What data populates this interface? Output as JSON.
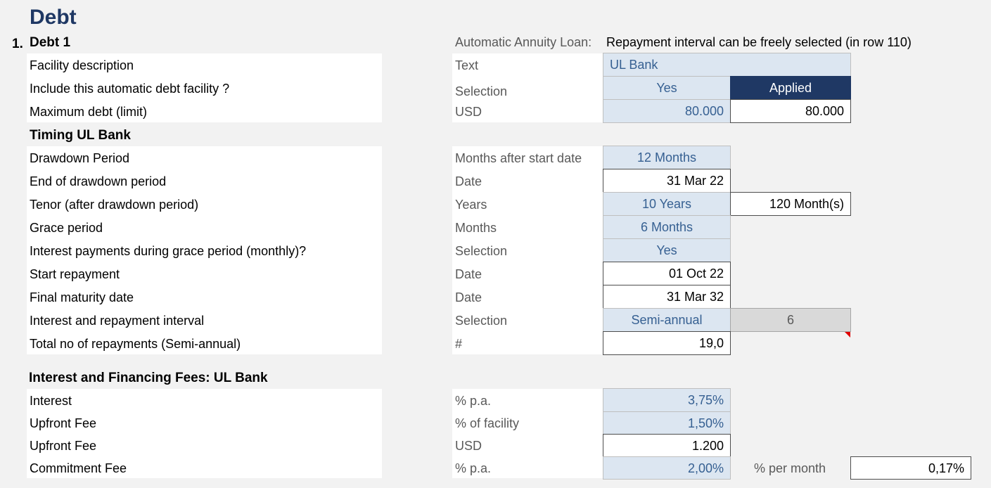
{
  "page_title": "Debt",
  "debt": {
    "number": "1.",
    "name": "Debt 1",
    "annuity_label": "Automatic Annuity Loan:",
    "annuity_note": "Repayment interval can be freely selected (in row 110)"
  },
  "rows": {
    "facility": {
      "label": "Facility description",
      "unit": "Text",
      "value": "UL Bank"
    },
    "include": {
      "label": "Include this automatic debt facility ?",
      "unit": "Selection",
      "value": "Yes",
      "status": "Applied"
    },
    "maxdebt": {
      "label": "Maximum debt (limit)",
      "unit": "USD",
      "value": "80.000",
      "calc": "80.000"
    },
    "drawdown": {
      "label": "Drawdown Period",
      "unit": "Months after start date",
      "value": "12 Months"
    },
    "enddraw": {
      "label": "End of drawdown period",
      "unit": "Date",
      "value": "31 Mar 22"
    },
    "tenor": {
      "label": "Tenor (after drawdown period)",
      "unit": "Years",
      "value": "10 Years",
      "calc": "120 Month(s)"
    },
    "grace": {
      "label": "Grace period",
      "unit": "Months",
      "value": "6 Months"
    },
    "graceint": {
      "label": "Interest payments during grace period (monthly)?",
      "unit": "Selection",
      "value": "Yes"
    },
    "startrep": {
      "label": "Start repayment",
      "unit": "Date",
      "value": "01 Oct 22"
    },
    "maturity": {
      "label": "Final maturity date",
      "unit": "Date",
      "value": "31 Mar 32"
    },
    "interval": {
      "label": "Interest and repayment interval",
      "unit": "Selection",
      "value": "Semi-annual",
      "calc": "6"
    },
    "norepay": {
      "label": "Total no of repayments (Semi-annual)",
      "unit": "#",
      "value": "19,0"
    },
    "interest": {
      "label": "Interest",
      "unit": "% p.a.",
      "value": "3,75%"
    },
    "upfrontpct": {
      "label": "Upfront Fee",
      "unit": "% of facility",
      "value": "1,50%"
    },
    "upfrontusd": {
      "label": "Upfront Fee",
      "unit": "USD",
      "value": "1.200"
    },
    "commit": {
      "label": "Commitment Fee",
      "unit": "% p.a.",
      "value": "2,00%",
      "extra_label": "% per month",
      "extra_value": "0,17%"
    }
  },
  "sections": {
    "timing": "Timing UL Bank",
    "fees": "Interest and Financing Fees: UL Bank"
  },
  "colors": {
    "input_fill": "#dce6f1",
    "input_text": "#366092",
    "applied_fill": "#1f3864",
    "title": "#1f3864",
    "background": "#f2f2f2"
  }
}
